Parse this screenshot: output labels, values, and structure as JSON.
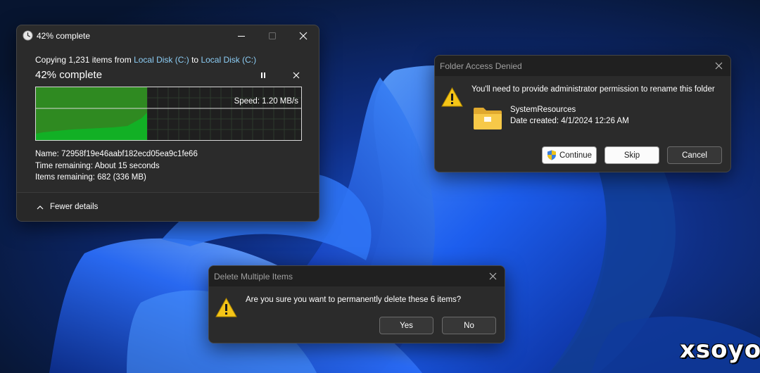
{
  "watermark": "xsoyo",
  "copy_window": {
    "title": "42% complete",
    "summary_prefix": "Copying 1,231 items from ",
    "source": "Local Disk (C:)",
    "summary_mid": " to ",
    "destination": "Local Disk (C:)",
    "status_heading": "42% complete",
    "progress_percent": 42,
    "speed": "Speed: 1.20 MB/s",
    "name_line": "Name: 72958f19e46aabf182ecd05ea9c1fe66",
    "time_remaining": "Time remaining: About 15 seconds",
    "items_remaining": "Items remaining: 682 (336 MB)",
    "fewer_details": "Fewer details"
  },
  "folder_dialog": {
    "title": "Folder Access Denied",
    "message": "You'll need to provide administrator permission to rename this folder",
    "folder_name": "SystemResources",
    "date_created": "Date created: 4/1/2024 12:26 AM",
    "buttons": {
      "continue": "Continue",
      "skip": "Skip",
      "cancel": "Cancel"
    }
  },
  "delete_dialog": {
    "title": "Delete Multiple Items",
    "message": "Are you sure you want to permanently delete these 6 items?",
    "buttons": {
      "yes": "Yes",
      "no": "No"
    }
  },
  "colors": {
    "accent_link": "#8ccdf5",
    "progress_green": "#12b025",
    "history_green": "#2f8a21",
    "warning_yellow": "#f5c518",
    "folder_yellow": "#f7c948"
  }
}
